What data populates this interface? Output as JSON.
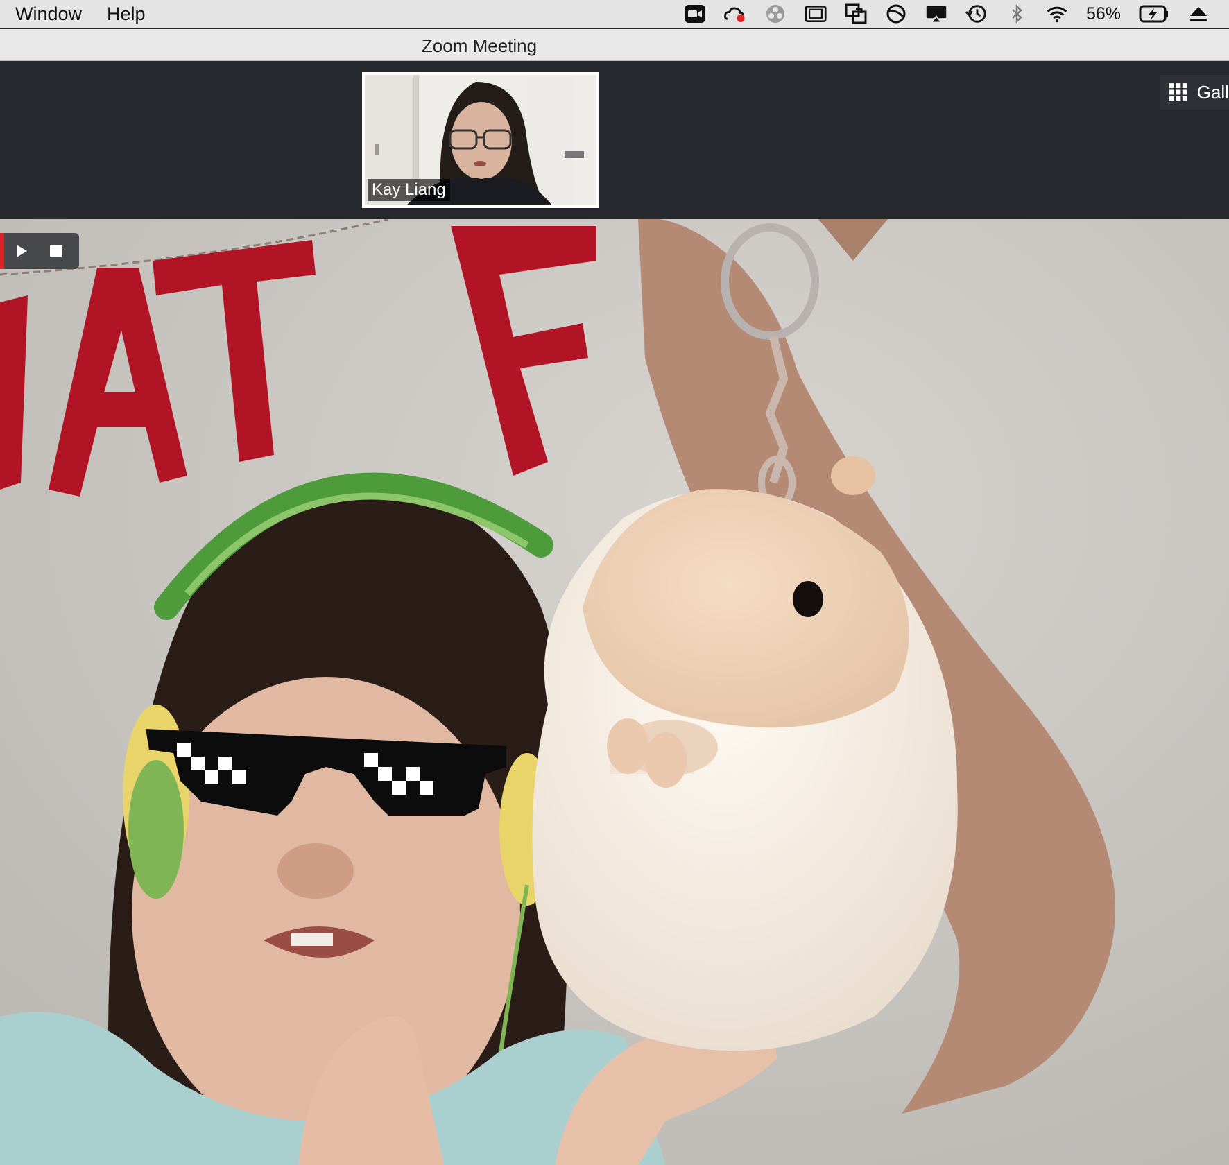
{
  "menubar": {
    "items": [
      "Window",
      "Help"
    ],
    "status_icons": [
      "zoom-camera-icon",
      "creative-cloud-icon",
      "color-wheel-icon",
      "screen-capture-icon",
      "screen-share-icon",
      "vpn-icon",
      "airplay-icon",
      "time-machine-icon",
      "bluetooth-icon",
      "wifi-icon",
      "battery-icon",
      "eject-icon"
    ],
    "battery_percent": "56%"
  },
  "window": {
    "title": "Zoom Meeting"
  },
  "thumbnail": {
    "participant_name": "Kay Liang"
  },
  "gallery": {
    "label": "Gall"
  },
  "recording": {
    "controls": [
      "play-icon",
      "stop-icon"
    ],
    "accent": "#e0262b"
  }
}
